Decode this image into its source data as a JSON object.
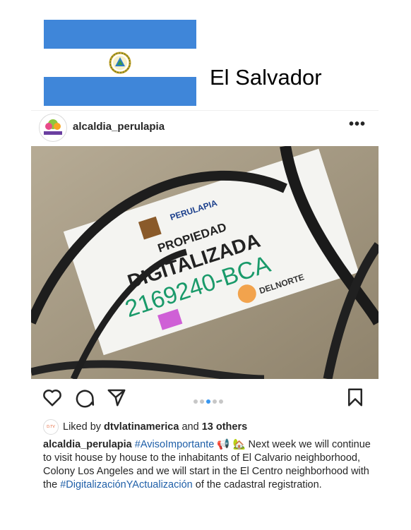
{
  "header": {
    "country": "El Salvador",
    "flag_colors": {
      "blue": "#3f86d9",
      "white": "#ffffff"
    }
  },
  "post": {
    "username": "alcaldia_perulapia",
    "avatar_text": "PERULAPIA",
    "more_icon": "ellipsis-icon",
    "photo": {
      "sign_title": "PERULAPIA",
      "sign_line1": "PROPIEDAD",
      "sign_line2": "DIGITALIZADA",
      "sign_code": "2169240-BCA",
      "sign_brand": "DELNORTE"
    },
    "actions": {
      "icons": [
        "heart-icon",
        "comment-icon",
        "share-icon",
        "bookmark-icon"
      ],
      "carousel_dots": 5,
      "active_dot": 3
    },
    "likes": {
      "avatar_text": "D.TV",
      "prefix": "Liked by",
      "user": "dtvlatinamerica",
      "and": "and",
      "others": "13 others"
    },
    "caption": {
      "user": "alcaldia_perulapia",
      "hashtag1": "#AvisoImportante",
      "emoji": "📢 🏡",
      "text1": "Next week we will continue to visit house by house to the inhabitants of El Calvario neighborhood, Colony Los Angeles and we will start in the El Centro neighborhood with the",
      "hashtag2": "#DigitalizaciónYActualización",
      "text2": "of the cadastral registration."
    }
  }
}
